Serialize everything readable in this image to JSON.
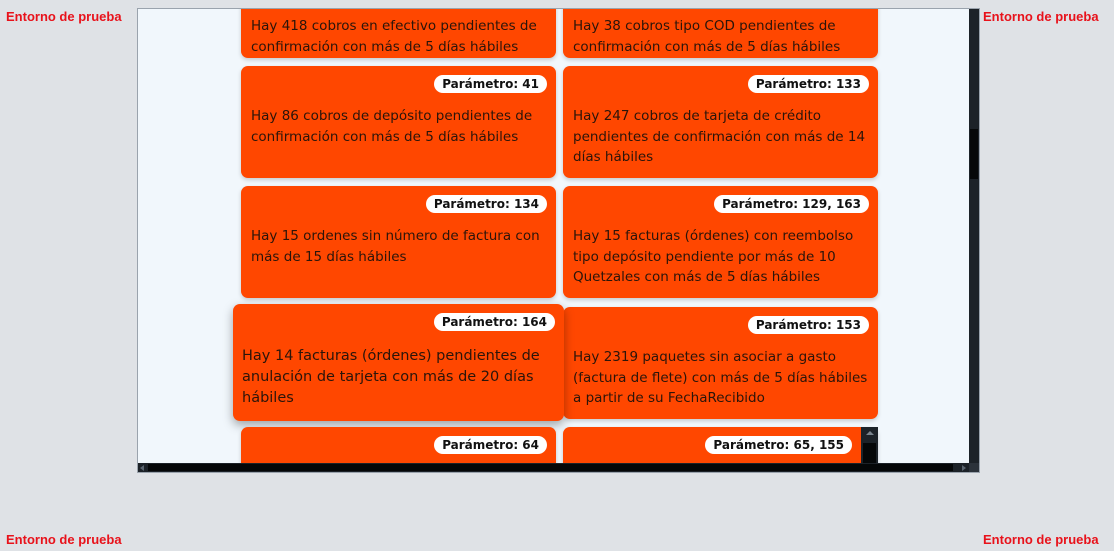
{
  "environment_label": "Entorno de prueba",
  "cards": [
    {
      "badge": "",
      "text": "Hay 418 cobros en efectivo pendientes de confirmación con más de 5 días hábiles"
    },
    {
      "badge": "",
      "text": "Hay 38 cobros tipo COD pendientes de confirmación con más de 5 días hábiles"
    },
    {
      "badge": "Parámetro: 41",
      "text": "Hay 86 cobros de depósito pendientes de confirmación con más de 5 días hábiles"
    },
    {
      "badge": "Parámetro: 133",
      "text": "Hay 247 cobros de tarjeta de crédito pendientes de confirmación con más de 14 días hábiles"
    },
    {
      "badge": "Parámetro: 134",
      "text": "Hay 15 ordenes sin número de factura con más de 15 días hábiles"
    },
    {
      "badge": "Parámetro: 129, 163",
      "text": "Hay 15 facturas (órdenes) con reembolso tipo depósito pendiente por más de 10 Quetzales con más de 5 días hábiles"
    },
    {
      "badge": "Parámetro: 164",
      "text": "Hay 14 facturas (órdenes) pendientes de anulación de tarjeta con más de 20 días hábiles"
    },
    {
      "badge": "Parámetro: 153",
      "text": "Hay 2319 paquetes sin asociar a gasto (factura de flete) con más de 5 días hábiles a partir de su FechaRecibido"
    },
    {
      "badge": "Parámetro: 64",
      "text": ""
    },
    {
      "badge": "Parámetro: 65, 155",
      "text": ""
    }
  ],
  "colors": {
    "card": "#ff4700",
    "badge_bg": "#ffffff",
    "env_label": "#e8121b",
    "page_bg": "#dfe2e6",
    "panel_bg": "#f1f7fc"
  }
}
